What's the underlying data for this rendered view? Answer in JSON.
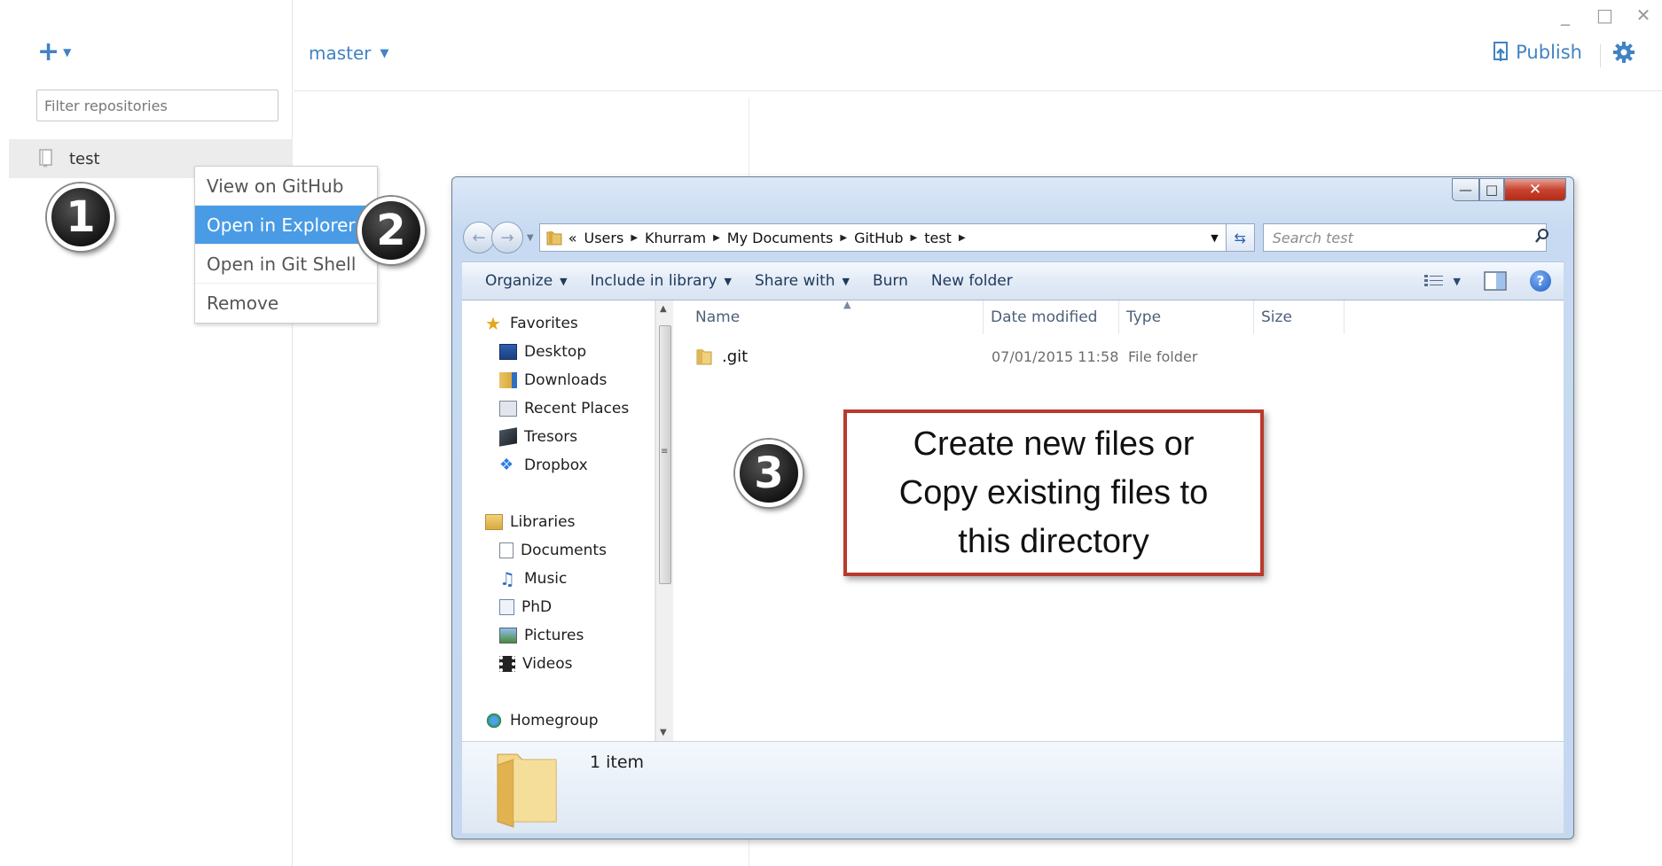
{
  "app": {
    "branch": "master",
    "publish_label": "Publish",
    "filter_placeholder": "Filter repositories",
    "repo_name": "test"
  },
  "context_menu": {
    "items": [
      {
        "label": "View on GitHub",
        "active": false
      },
      {
        "label": "Open in Explorer",
        "active": true
      },
      {
        "label": "Open in Git Shell",
        "active": false
      },
      {
        "label": "Remove",
        "active": false
      }
    ]
  },
  "steps": {
    "one": "1",
    "two": "2",
    "three": "3"
  },
  "explorer": {
    "breadcrumb": [
      "Users",
      "Khurram",
      "My Documents",
      "GitHub",
      "test"
    ],
    "breadcrumb_prefix": "«",
    "search_placeholder": "Search test",
    "commands": [
      "Organize",
      "Include in library",
      "Share with",
      "Burn",
      "New folder"
    ],
    "favorites_label": "Favorites",
    "favorites": [
      "Desktop",
      "Downloads",
      "Recent Places",
      "Tresors",
      "Dropbox"
    ],
    "libraries_label": "Libraries",
    "libraries": [
      "Documents",
      "Music",
      "PhD",
      "Pictures",
      "Videos"
    ],
    "homegroup_label": "Homegroup",
    "columns": {
      "name": "Name",
      "date": "Date modified",
      "type": "Type",
      "size": "Size"
    },
    "files": [
      {
        "name": ".git",
        "date": "07/01/2015 11:58",
        "type": "File folder"
      }
    ],
    "status_count": "1 item"
  },
  "callout": {
    "line1": "Create new files or",
    "line2": "Copy existing files to",
    "line3": "this directory"
  },
  "colors": {
    "accent": "#4183c4",
    "menu_active": "#4a9be5",
    "callout_border": "#b73b2c"
  }
}
